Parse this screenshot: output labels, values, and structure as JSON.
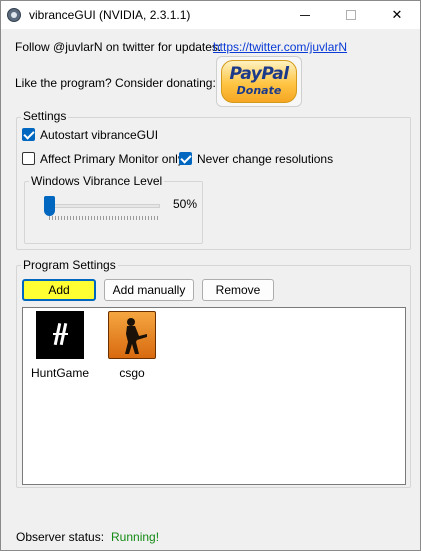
{
  "window": {
    "title": "vibranceGUI (NVIDIA, 2.3.1.1)"
  },
  "header": {
    "follow_text": "Follow @juvlarN on twitter for updates:",
    "twitter_link": "https://twitter.com/juvlarN",
    "donate_text": "Like the program? Consider donating:",
    "paypal_logo_text": "PayPal",
    "paypal_donate_text": "Donate"
  },
  "settings": {
    "group_title": "Settings",
    "autostart_label": "Autostart vibranceGUI",
    "autostart_checked": true,
    "affect_primary_label": "Affect Primary Monitor only",
    "affect_primary_checked": false,
    "never_change_res_label": "Never change resolutions",
    "never_change_res_checked": true,
    "vibrance": {
      "group_title": "Windows Vibrance Level",
      "value_text": "50%",
      "level": 0.0
    }
  },
  "program_settings": {
    "group_title": "Program Settings",
    "buttons": {
      "add": "Add",
      "add_manually": "Add manually",
      "remove": "Remove"
    },
    "programs": [
      {
        "name": "HuntGame",
        "icon": "hunt-game-icon"
      },
      {
        "name": "csgo",
        "icon": "csgo-icon"
      }
    ]
  },
  "status": {
    "label": "Observer status:",
    "value": "Running!",
    "value_color": "#138a13"
  },
  "colors": {
    "accent": "#0067c0",
    "add_button_bg": "#ffff33",
    "link": "#0a3bd6"
  }
}
